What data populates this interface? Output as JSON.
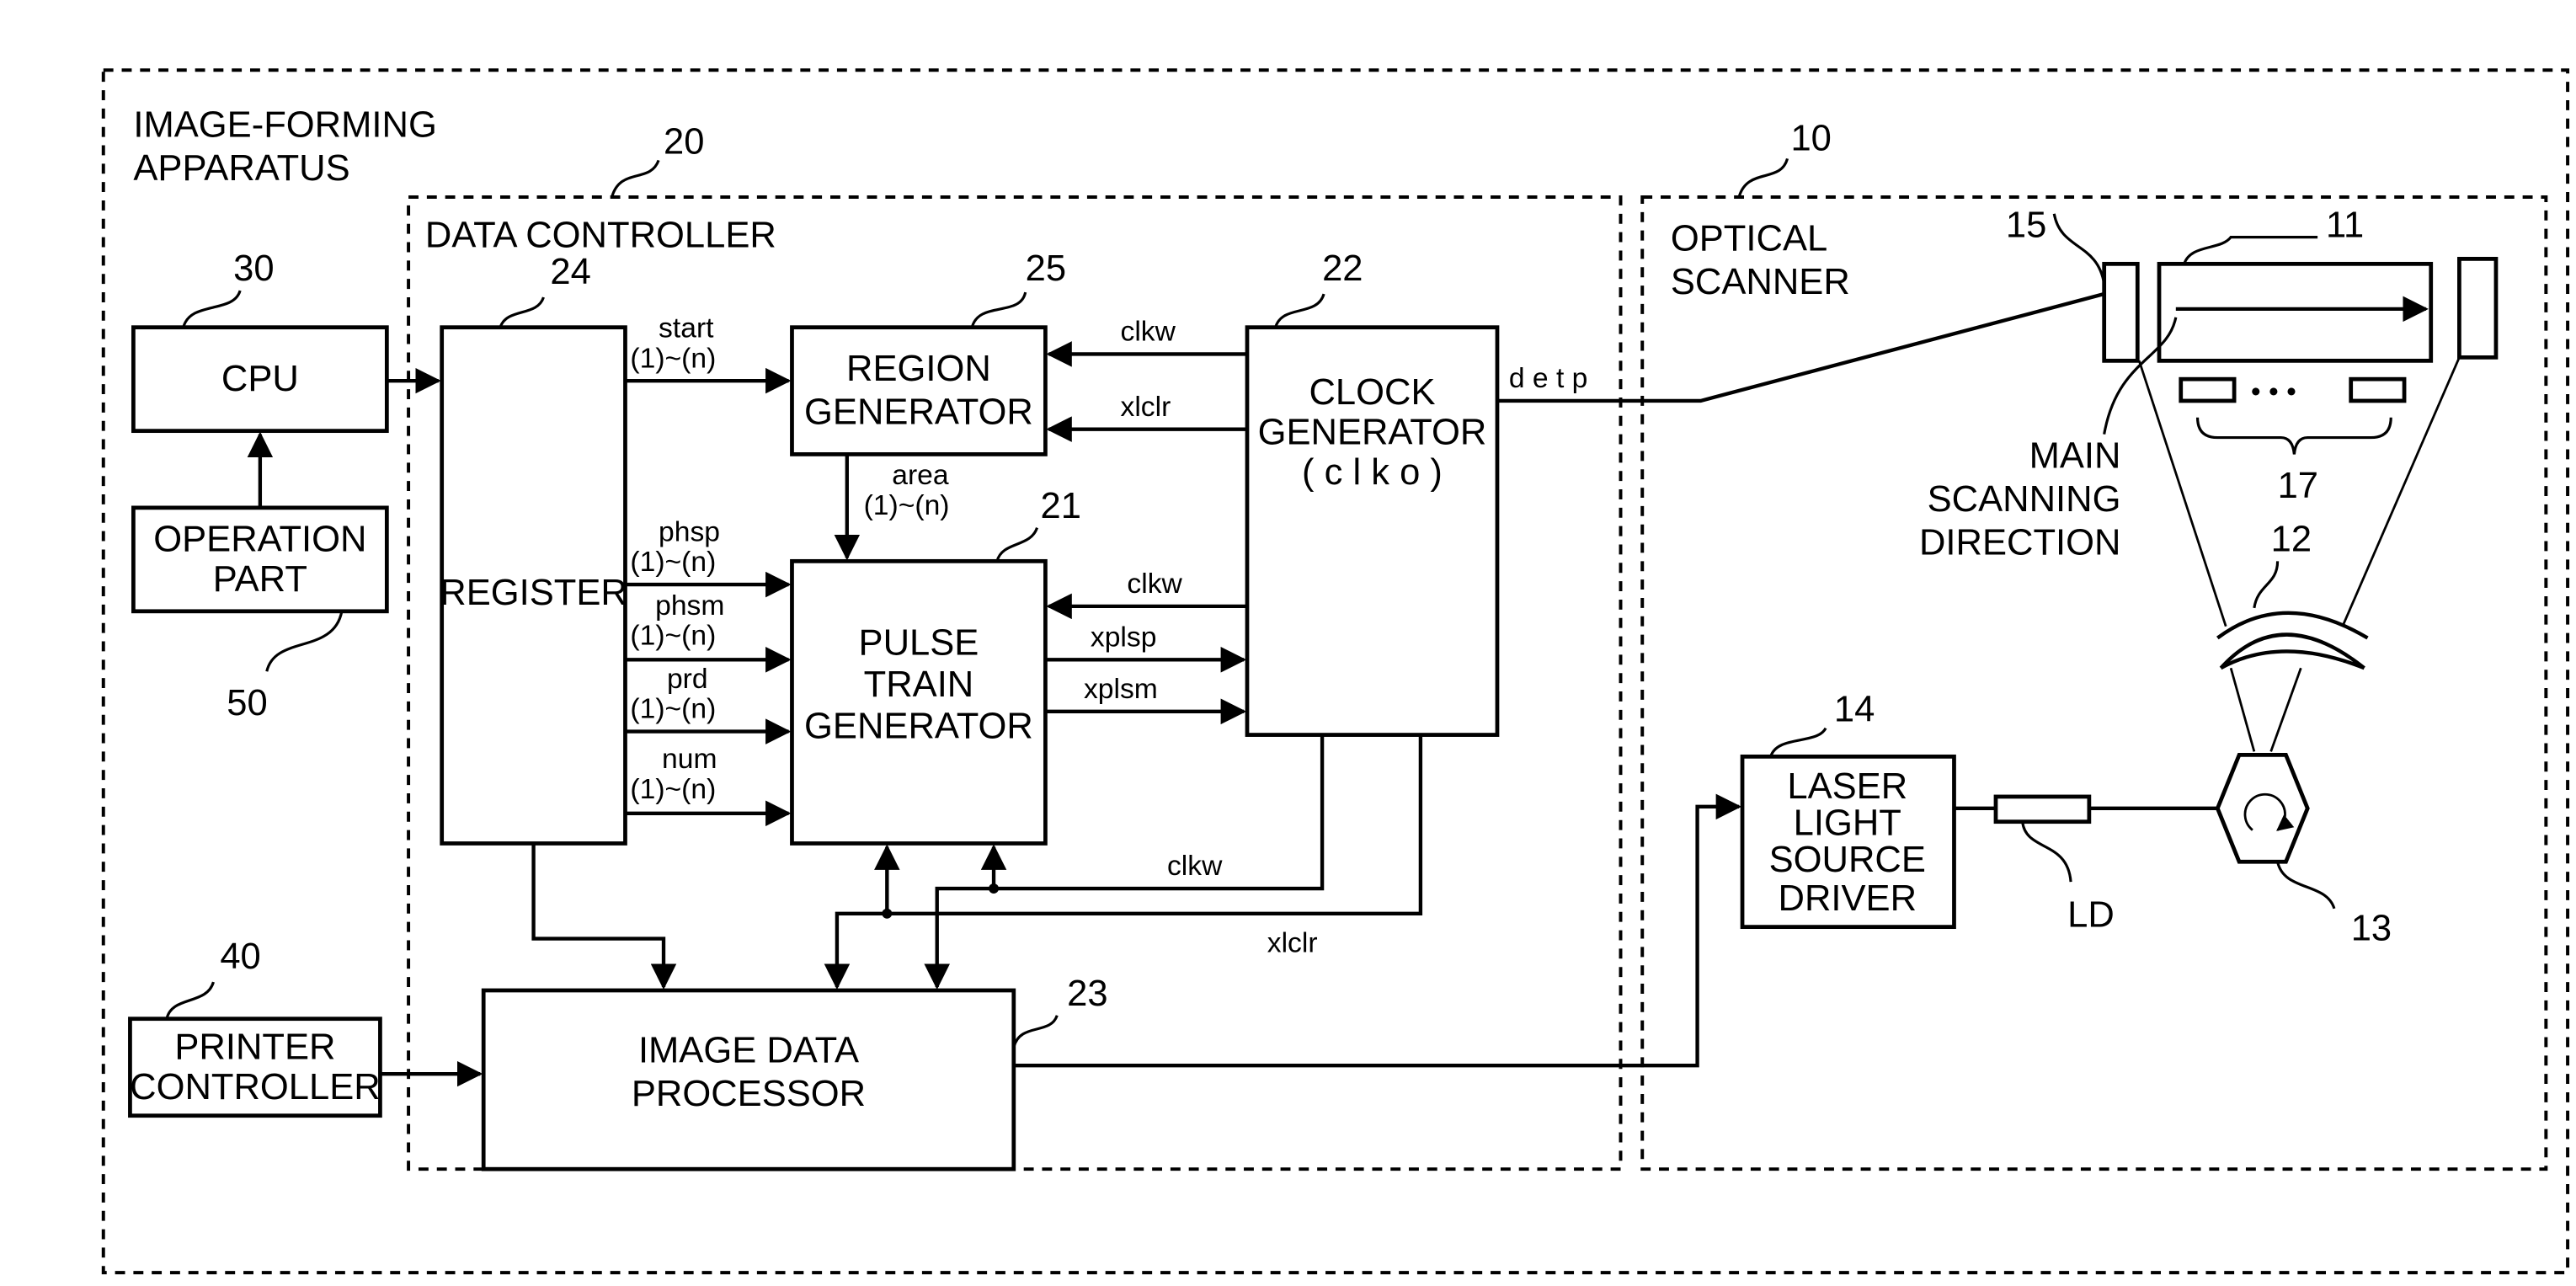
{
  "diagram": {
    "outer": {
      "title_line1": "IMAGE-FORMING",
      "title_line2": "APPARATUS"
    },
    "data_controller": {
      "title": "DATA CONTROLLER",
      "ref": "20"
    },
    "optical_scanner": {
      "title_line1": "OPTICAL",
      "title_line2": "SCANNER",
      "ref": "10"
    },
    "blocks": {
      "cpu": {
        "label": "CPU",
        "ref": "30"
      },
      "operation_part": {
        "line1": "OPERATION",
        "line2": "PART",
        "ref": "50"
      },
      "register": {
        "label": "REGISTER",
        "ref": "24"
      },
      "region_generator": {
        "line1": "REGION",
        "line2": "GENERATOR",
        "ref": "25"
      },
      "pulse_train_generator": {
        "line1": "PULSE",
        "line2": "TRAIN",
        "line3": "GENERATOR",
        "ref": "21"
      },
      "clock_generator": {
        "line1": "CLOCK",
        "line2": "GENERATOR",
        "line3": "( c l k o )",
        "ref": "22"
      },
      "image_data_processor": {
        "line1": "IMAGE DATA",
        "line2": "PROCESSOR",
        "ref": "23"
      },
      "printer_controller": {
        "line1": "PRINTER",
        "line2": "CONTROLLER",
        "ref": "40"
      },
      "laser_driver": {
        "line1": "LASER",
        "line2": "LIGHT",
        "line3": "SOURCE",
        "line4": "DRIVER",
        "ref": "14"
      }
    },
    "signals": {
      "start": "start",
      "start_range": "(1)~(n)",
      "area": "area",
      "area_range": "(1)~(n)",
      "phsp": "phsp",
      "phsp_range": "(1)~(n)",
      "phsm": "phsm",
      "phsm_range": "(1)~(n)",
      "prd": "prd",
      "prd_range": "(1)~(n)",
      "num": "num",
      "num_range": "(1)~(n)",
      "clkw_region": "clkw",
      "xlclr_region": "xlclr",
      "clkw_pulse": "clkw",
      "xplsp": "xplsp",
      "xplsm": "xplsm",
      "clkw_bottom": "clkw",
      "xlclr_bottom": "xlclr",
      "detp": "d e t p"
    },
    "optics": {
      "scan_surface_ref": "11",
      "lens_ref": "12",
      "polygon_ref": "13",
      "sensor_ref": "15",
      "sensor_group_ref": "17",
      "ld_label": "LD",
      "main_scan_line1": "MAIN",
      "main_scan_line2": "SCANNING",
      "main_scan_line3": "DIRECTION",
      "dots": "• • •"
    }
  }
}
